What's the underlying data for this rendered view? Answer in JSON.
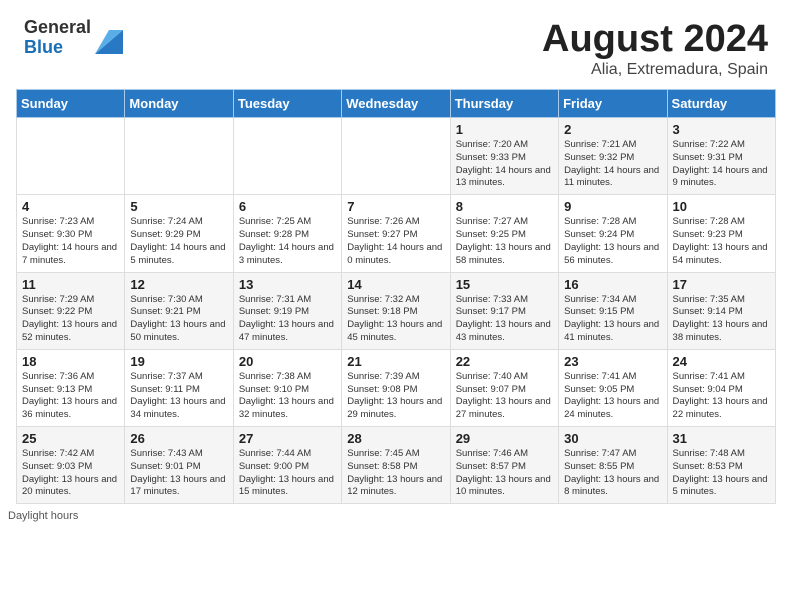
{
  "header": {
    "logo_general": "General",
    "logo_blue": "Blue",
    "title": "August 2024",
    "subtitle": "Alia, Extremadura, Spain"
  },
  "days_of_week": [
    "Sunday",
    "Monday",
    "Tuesday",
    "Wednesday",
    "Thursday",
    "Friday",
    "Saturday"
  ],
  "weeks": [
    [
      {
        "day": "",
        "info": ""
      },
      {
        "day": "",
        "info": ""
      },
      {
        "day": "",
        "info": ""
      },
      {
        "day": "",
        "info": ""
      },
      {
        "day": "1",
        "info": "Sunrise: 7:20 AM\nSunset: 9:33 PM\nDaylight: 14 hours\nand 13 minutes."
      },
      {
        "day": "2",
        "info": "Sunrise: 7:21 AM\nSunset: 9:32 PM\nDaylight: 14 hours\nand 11 minutes."
      },
      {
        "day": "3",
        "info": "Sunrise: 7:22 AM\nSunset: 9:31 PM\nDaylight: 14 hours\nand 9 minutes."
      }
    ],
    [
      {
        "day": "4",
        "info": "Sunrise: 7:23 AM\nSunset: 9:30 PM\nDaylight: 14 hours\nand 7 minutes."
      },
      {
        "day": "5",
        "info": "Sunrise: 7:24 AM\nSunset: 9:29 PM\nDaylight: 14 hours\nand 5 minutes."
      },
      {
        "day": "6",
        "info": "Sunrise: 7:25 AM\nSunset: 9:28 PM\nDaylight: 14 hours\nand 3 minutes."
      },
      {
        "day": "7",
        "info": "Sunrise: 7:26 AM\nSunset: 9:27 PM\nDaylight: 14 hours\nand 0 minutes."
      },
      {
        "day": "8",
        "info": "Sunrise: 7:27 AM\nSunset: 9:25 PM\nDaylight: 13 hours\nand 58 minutes."
      },
      {
        "day": "9",
        "info": "Sunrise: 7:28 AM\nSunset: 9:24 PM\nDaylight: 13 hours\nand 56 minutes."
      },
      {
        "day": "10",
        "info": "Sunrise: 7:28 AM\nSunset: 9:23 PM\nDaylight: 13 hours\nand 54 minutes."
      }
    ],
    [
      {
        "day": "11",
        "info": "Sunrise: 7:29 AM\nSunset: 9:22 PM\nDaylight: 13 hours\nand 52 minutes."
      },
      {
        "day": "12",
        "info": "Sunrise: 7:30 AM\nSunset: 9:21 PM\nDaylight: 13 hours\nand 50 minutes."
      },
      {
        "day": "13",
        "info": "Sunrise: 7:31 AM\nSunset: 9:19 PM\nDaylight: 13 hours\nand 47 minutes."
      },
      {
        "day": "14",
        "info": "Sunrise: 7:32 AM\nSunset: 9:18 PM\nDaylight: 13 hours\nand 45 minutes."
      },
      {
        "day": "15",
        "info": "Sunrise: 7:33 AM\nSunset: 9:17 PM\nDaylight: 13 hours\nand 43 minutes."
      },
      {
        "day": "16",
        "info": "Sunrise: 7:34 AM\nSunset: 9:15 PM\nDaylight: 13 hours\nand 41 minutes."
      },
      {
        "day": "17",
        "info": "Sunrise: 7:35 AM\nSunset: 9:14 PM\nDaylight: 13 hours\nand 38 minutes."
      }
    ],
    [
      {
        "day": "18",
        "info": "Sunrise: 7:36 AM\nSunset: 9:13 PM\nDaylight: 13 hours\nand 36 minutes."
      },
      {
        "day": "19",
        "info": "Sunrise: 7:37 AM\nSunset: 9:11 PM\nDaylight: 13 hours\nand 34 minutes."
      },
      {
        "day": "20",
        "info": "Sunrise: 7:38 AM\nSunset: 9:10 PM\nDaylight: 13 hours\nand 32 minutes."
      },
      {
        "day": "21",
        "info": "Sunrise: 7:39 AM\nSunset: 9:08 PM\nDaylight: 13 hours\nand 29 minutes."
      },
      {
        "day": "22",
        "info": "Sunrise: 7:40 AM\nSunset: 9:07 PM\nDaylight: 13 hours\nand 27 minutes."
      },
      {
        "day": "23",
        "info": "Sunrise: 7:41 AM\nSunset: 9:05 PM\nDaylight: 13 hours\nand 24 minutes."
      },
      {
        "day": "24",
        "info": "Sunrise: 7:41 AM\nSunset: 9:04 PM\nDaylight: 13 hours\nand 22 minutes."
      }
    ],
    [
      {
        "day": "25",
        "info": "Sunrise: 7:42 AM\nSunset: 9:03 PM\nDaylight: 13 hours\nand 20 minutes."
      },
      {
        "day": "26",
        "info": "Sunrise: 7:43 AM\nSunset: 9:01 PM\nDaylight: 13 hours\nand 17 minutes."
      },
      {
        "day": "27",
        "info": "Sunrise: 7:44 AM\nSunset: 9:00 PM\nDaylight: 13 hours\nand 15 minutes."
      },
      {
        "day": "28",
        "info": "Sunrise: 7:45 AM\nSunset: 8:58 PM\nDaylight: 13 hours\nand 12 minutes."
      },
      {
        "day": "29",
        "info": "Sunrise: 7:46 AM\nSunset: 8:57 PM\nDaylight: 13 hours\nand 10 minutes."
      },
      {
        "day": "30",
        "info": "Sunrise: 7:47 AM\nSunset: 8:55 PM\nDaylight: 13 hours\nand 8 minutes."
      },
      {
        "day": "31",
        "info": "Sunrise: 7:48 AM\nSunset: 8:53 PM\nDaylight: 13 hours\nand 5 minutes."
      }
    ]
  ],
  "footer": {
    "note": "Daylight hours"
  }
}
